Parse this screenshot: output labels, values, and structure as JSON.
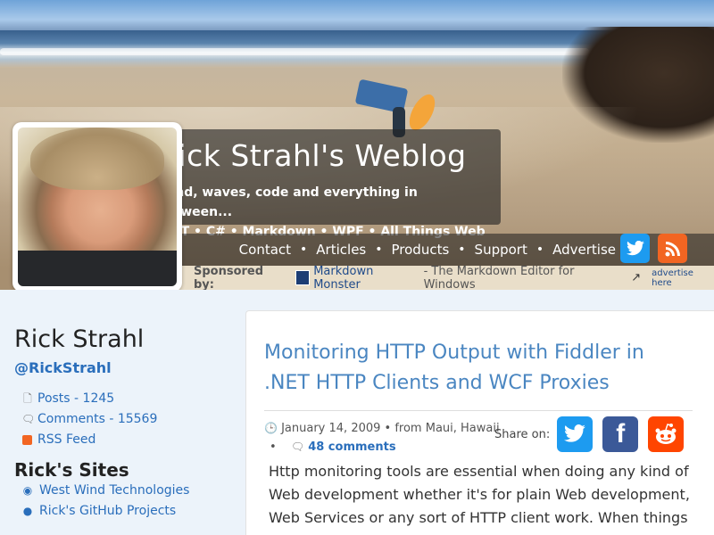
{
  "header": {
    "site_title": "Rick Strahl's Weblog",
    "tagline_1": "Wind, waves, code and everything in between...",
    "tagline_2": ".NET • C# • Markdown • WPF • All Things Web"
  },
  "nav": {
    "items": [
      "Contact",
      "Articles",
      "Products",
      "Support",
      "Advertise"
    ],
    "separator": "•"
  },
  "social": {
    "twitter_icon": "twitter-icon",
    "rss_icon": "rss-icon"
  },
  "sponsor": {
    "label": "Sponsored by:",
    "product": "Markdown Monster",
    "description": "- The Markdown Editor for Windows",
    "advertise": "advertise here"
  },
  "sidebar": {
    "author": "Rick Strahl",
    "handle": "@RickStrahl",
    "posts": "Posts - 1245",
    "comments": "Comments - 15569",
    "rss": "RSS Feed",
    "sites_title": "Rick's Sites",
    "sites": [
      "West Wind Technologies",
      "Rick's GitHub Projects"
    ]
  },
  "article": {
    "title": "Monitoring HTTP Output with Fiddler in .NET HTTP Clients and WCF Proxies",
    "date": "January 14, 2009",
    "location": "• from Maui, Hawaii",
    "bullet": "•",
    "comments": "48 comments",
    "share_label": "Share on:",
    "body": "Http monitoring tools are essential when doing any kind of Web development whether it's for plain Web development, Web Services or any sort of HTTP client work. When things go"
  },
  "colors": {
    "link": "#2a6ebb",
    "title": "#4a86c1",
    "twitter": "#1d9bf0",
    "facebook": "#3b5998",
    "reddit": "#ff4500",
    "rss": "#f26522"
  }
}
